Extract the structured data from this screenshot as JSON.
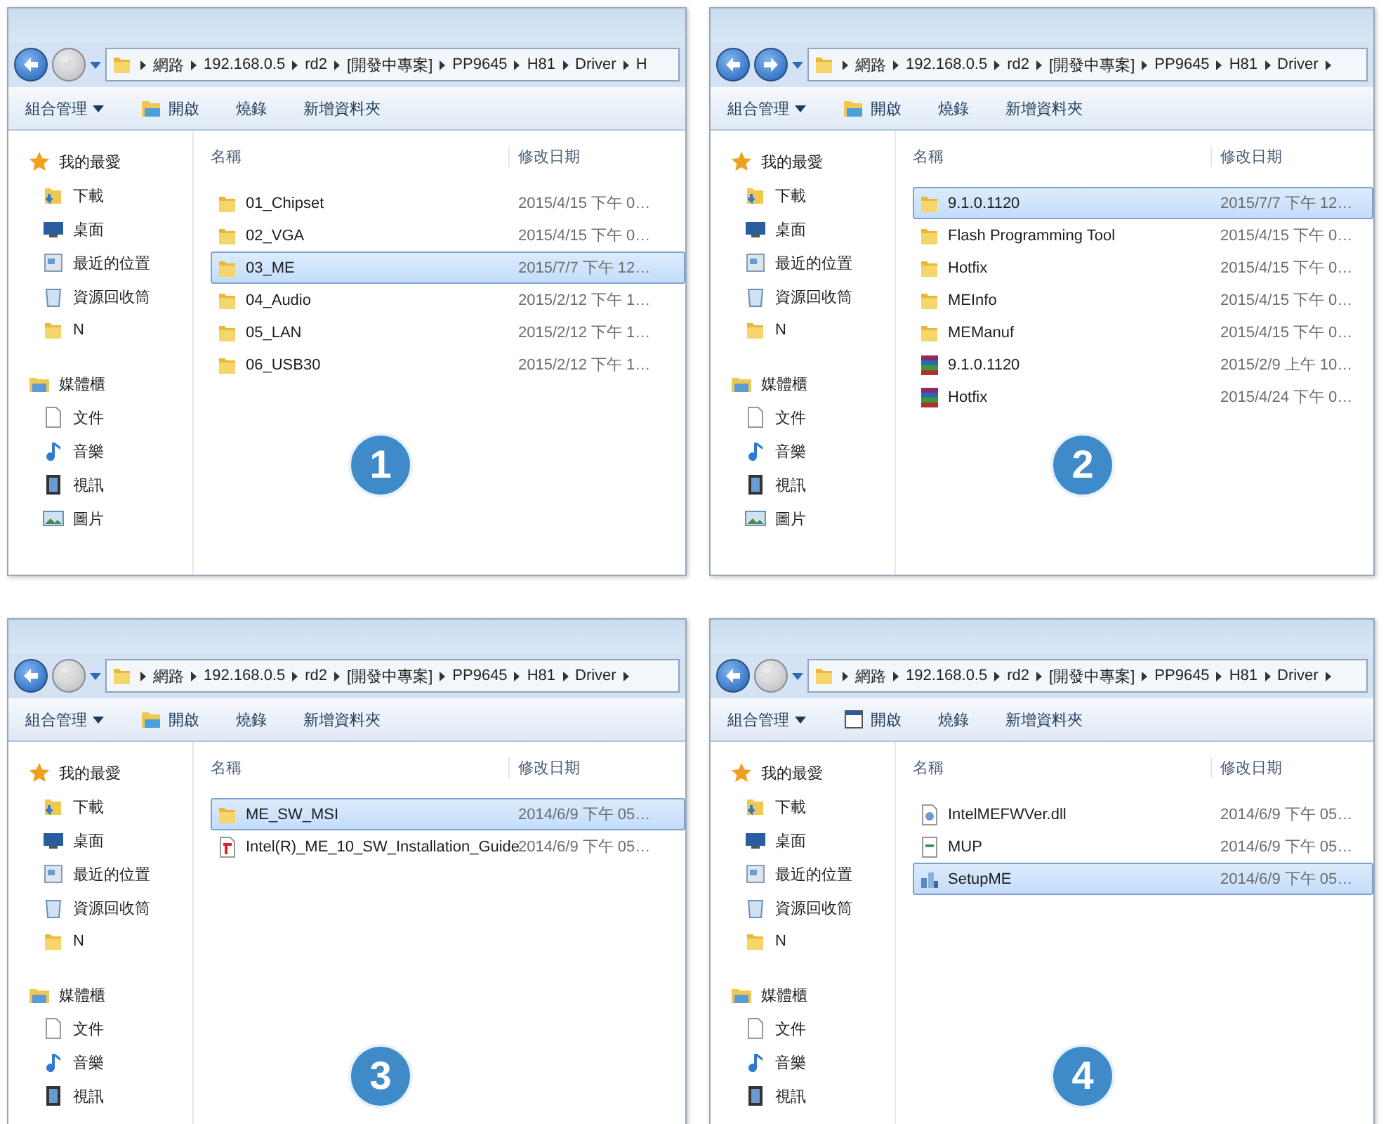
{
  "panels": [
    {
      "step": "1",
      "forward_enabled": false,
      "path": [
        "網路",
        "192.168.0.5",
        "rd2",
        "[開發中專案]",
        "PP9645",
        "H81",
        "Driver",
        "H"
      ],
      "toolbar": [
        {
          "label": "組合管理",
          "kind": "menu"
        },
        {
          "label": "開啟",
          "kind": "open"
        },
        {
          "label": "燒錄",
          "kind": "plain"
        },
        {
          "label": "新增資料夾",
          "kind": "plain"
        }
      ],
      "sidebar": [
        {
          "label": "我的最愛",
          "kind": "favorites",
          "children": [
            {
              "label": "下載",
              "kind": "downloads"
            },
            {
              "label": "桌面",
              "kind": "desktop"
            },
            {
              "label": "最近的位置",
              "kind": "recent"
            },
            {
              "label": "資源回收筒",
              "kind": "recycle"
            },
            {
              "label": "N",
              "kind": "folder"
            }
          ]
        },
        {
          "label": "媒體櫃",
          "kind": "libraries",
          "children": [
            {
              "label": "文件",
              "kind": "documents"
            },
            {
              "label": "音樂",
              "kind": "music"
            },
            {
              "label": "視訊",
              "kind": "videos"
            },
            {
              "label": "圖片",
              "kind": "pictures"
            }
          ]
        }
      ],
      "columns": [
        "名稱",
        "修改日期"
      ],
      "files": [
        {
          "name": "01_Chipset",
          "date": "2015/4/15 下午 0…",
          "kind": "folder",
          "selected": false
        },
        {
          "name": "02_VGA",
          "date": "2015/4/15 下午 0…",
          "kind": "folder",
          "selected": false
        },
        {
          "name": "03_ME",
          "date": "2015/7/7 下午 12…",
          "kind": "folder",
          "selected": true
        },
        {
          "name": "04_Audio",
          "date": "2015/2/12 下午 1…",
          "kind": "folder",
          "selected": false
        },
        {
          "name": "05_LAN",
          "date": "2015/2/12 下午 1…",
          "kind": "folder",
          "selected": false
        },
        {
          "name": "06_USB30",
          "date": "2015/2/12 下午 1…",
          "kind": "folder",
          "selected": false
        }
      ]
    },
    {
      "step": "2",
      "forward_enabled": true,
      "path": [
        "網路",
        "192.168.0.5",
        "rd2",
        "[開發中專案]",
        "PP9645",
        "H81",
        "Driver"
      ],
      "toolbar": [
        {
          "label": "組合管理",
          "kind": "menu"
        },
        {
          "label": "開啟",
          "kind": "open"
        },
        {
          "label": "燒錄",
          "kind": "plain"
        },
        {
          "label": "新增資料夾",
          "kind": "plain"
        }
      ],
      "sidebar": [
        {
          "label": "我的最愛",
          "kind": "favorites",
          "children": [
            {
              "label": "下載",
              "kind": "downloads"
            },
            {
              "label": "桌面",
              "kind": "desktop"
            },
            {
              "label": "最近的位置",
              "kind": "recent"
            },
            {
              "label": "資源回收筒",
              "kind": "recycle"
            },
            {
              "label": "N",
              "kind": "folder"
            }
          ]
        },
        {
          "label": "媒體櫃",
          "kind": "libraries",
          "children": [
            {
              "label": "文件",
              "kind": "documents"
            },
            {
              "label": "音樂",
              "kind": "music"
            },
            {
              "label": "視訊",
              "kind": "videos"
            },
            {
              "label": "圖片",
              "kind": "pictures"
            }
          ]
        }
      ],
      "columns": [
        "名稱",
        "修改日期"
      ],
      "files": [
        {
          "name": "9.1.0.1120",
          "date": "2015/7/7 下午 12…",
          "kind": "folder",
          "selected": true
        },
        {
          "name": "Flash Programming Tool",
          "date": "2015/4/15 下午 0…",
          "kind": "folder",
          "selected": false
        },
        {
          "name": "Hotfix",
          "date": "2015/4/15 下午 0…",
          "kind": "folder",
          "selected": false
        },
        {
          "name": "MEInfo",
          "date": "2015/4/15 下午 0…",
          "kind": "folder",
          "selected": false
        },
        {
          "name": "MEManuf",
          "date": "2015/4/15 下午 0…",
          "kind": "folder",
          "selected": false
        },
        {
          "name": "9.1.0.1120",
          "date": "2015/2/9 上午 10…",
          "kind": "archive",
          "selected": false
        },
        {
          "name": "Hotfix",
          "date": "2015/4/24 下午 0…",
          "kind": "archive",
          "selected": false
        }
      ]
    },
    {
      "step": "3",
      "forward_enabled": false,
      "path": [
        "網路",
        "192.168.0.5",
        "rd2",
        "[開發中專案]",
        "PP9645",
        "H81",
        "Driver"
      ],
      "toolbar": [
        {
          "label": "組合管理",
          "kind": "menu"
        },
        {
          "label": "開啟",
          "kind": "open"
        },
        {
          "label": "燒錄",
          "kind": "plain"
        },
        {
          "label": "新增資料夾",
          "kind": "plain"
        }
      ],
      "sidebar": [
        {
          "label": "我的最愛",
          "kind": "favorites",
          "children": [
            {
              "label": "下載",
              "kind": "downloads"
            },
            {
              "label": "桌面",
              "kind": "desktop"
            },
            {
              "label": "最近的位置",
              "kind": "recent"
            },
            {
              "label": "資源回收筒",
              "kind": "recycle"
            },
            {
              "label": "N",
              "kind": "folder"
            }
          ]
        },
        {
          "label": "媒體櫃",
          "kind": "libraries",
          "children": [
            {
              "label": "文件",
              "kind": "documents"
            },
            {
              "label": "音樂",
              "kind": "music"
            },
            {
              "label": "視訊",
              "kind": "videos"
            }
          ]
        }
      ],
      "columns": [
        "名稱",
        "修改日期"
      ],
      "files": [
        {
          "name": "ME_SW_MSI",
          "date": "2014/6/9 下午 05…",
          "kind": "folder",
          "selected": true
        },
        {
          "name": "Intel(R)_ME_10_SW_Installation_Guide",
          "date": "2014/6/9 下午 05…",
          "kind": "pdf",
          "selected": false
        }
      ]
    },
    {
      "step": "4",
      "forward_enabled": false,
      "path": [
        "網路",
        "192.168.0.5",
        "rd2",
        "[開發中專案]",
        "PP9645",
        "H81",
        "Driver"
      ],
      "toolbar": [
        {
          "label": "組合管理",
          "kind": "menu"
        },
        {
          "label": "開啟",
          "kind": "run"
        },
        {
          "label": "燒錄",
          "kind": "plain"
        },
        {
          "label": "新增資料夾",
          "kind": "plain"
        }
      ],
      "sidebar": [
        {
          "label": "我的最愛",
          "kind": "favorites",
          "children": [
            {
              "label": "下載",
              "kind": "downloads"
            },
            {
              "label": "桌面",
              "kind": "desktop"
            },
            {
              "label": "最近的位置",
              "kind": "recent"
            },
            {
              "label": "資源回收筒",
              "kind": "recycle"
            },
            {
              "label": "N",
              "kind": "folder"
            }
          ]
        },
        {
          "label": "媒體櫃",
          "kind": "libraries",
          "children": [
            {
              "label": "文件",
              "kind": "documents"
            },
            {
              "label": "音樂",
              "kind": "music"
            },
            {
              "label": "視訊",
              "kind": "videos"
            }
          ]
        }
      ],
      "columns": [
        "名稱",
        "修改日期"
      ],
      "files": [
        {
          "name": "IntelMEFWVer.dll",
          "date": "2014/6/9 下午 05…",
          "kind": "dll",
          "selected": false
        },
        {
          "name": "MUP",
          "date": "2014/6/9 下午 05…",
          "kind": "config",
          "selected": false
        },
        {
          "name": "SetupME",
          "date": "2014/6/9 下午 05…",
          "kind": "setup",
          "selected": true
        }
      ]
    }
  ]
}
